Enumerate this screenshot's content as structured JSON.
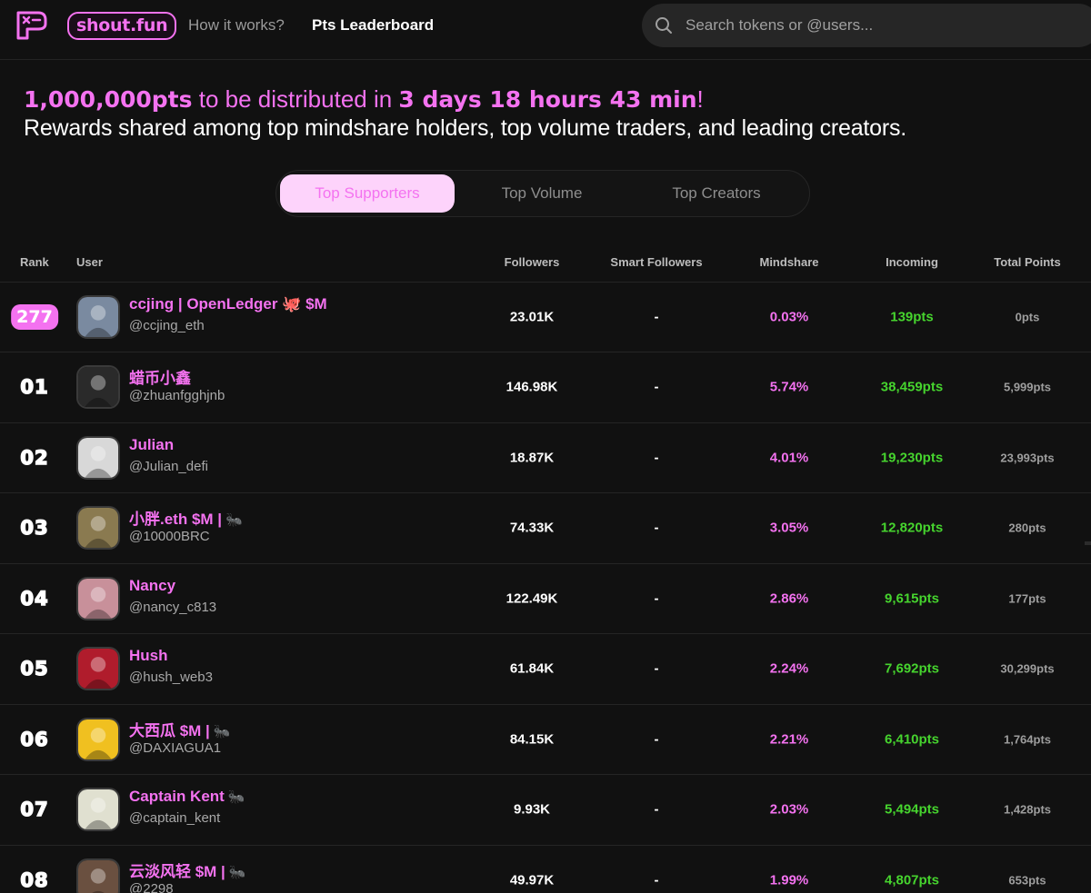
{
  "brand": {
    "name": "shout.fun"
  },
  "nav": {
    "how_it_works": "How it works?",
    "leaderboard": "Pts Leaderboard"
  },
  "search": {
    "placeholder": "Search tokens or @users..."
  },
  "banner": {
    "amount": "1,000,000pts",
    "mid_text": " to be distributed in ",
    "time": "3 days 18 hours 43 min",
    "suffix": "!",
    "subtitle": "Rewards shared among top mindshare holders, top volume traders, and leading creators."
  },
  "tabs": [
    "Top Supporters",
    "Top Volume",
    "Top Creators"
  ],
  "active_tab": "Top Supporters",
  "table": {
    "headers": {
      "rank": "Rank",
      "user": "User",
      "followers": "Followers",
      "smart_followers": "Smart Followers",
      "mindshare": "Mindshare",
      "incoming": "Incoming",
      "total_points": "Total Points"
    },
    "rows": [
      {
        "rank": "277",
        "name": "ccjing | OpenLedger 🐙 $M",
        "handle": "@ccjing_eth",
        "followers": "23.01K",
        "smart_followers": "-",
        "mindshare": "0.03%",
        "incoming": "139pts",
        "total_points": "0pts",
        "avatar_color": "#7a8aa0",
        "current_user": true
      },
      {
        "rank": "01",
        "name": "蜡币小鑫",
        "handle": "@zhuanfgghjnb",
        "followers": "146.98K",
        "smart_followers": "-",
        "mindshare": "5.74%",
        "incoming": "38,459pts",
        "total_points": "5,999pts",
        "avatar_color": "#2a2a2a"
      },
      {
        "rank": "02",
        "name": "Julian",
        "handle": "@Julian_defi",
        "followers": "18.87K",
        "smart_followers": "-",
        "mindshare": "4.01%",
        "incoming": "19,230pts",
        "total_points": "23,993pts",
        "avatar_color": "#d8d8d8"
      },
      {
        "rank": "03",
        "name": "小胖.eth $M |",
        "handle": "@10000BRC",
        "followers": "74.33K",
        "smart_followers": "-",
        "mindshare": "3.05%",
        "incoming": "12,820pts",
        "total_points": "280pts",
        "avatar_color": "#8a7a50",
        "ant": "🐜"
      },
      {
        "rank": "04",
        "name": "Nancy",
        "handle": "@nancy_c813",
        "followers": "122.49K",
        "smart_followers": "-",
        "mindshare": "2.86%",
        "incoming": "9,615pts",
        "total_points": "177pts",
        "avatar_color": "#c8909a"
      },
      {
        "rank": "05",
        "name": "Hush",
        "handle": "@hush_web3",
        "followers": "61.84K",
        "smart_followers": "-",
        "mindshare": "2.24%",
        "incoming": "7,692pts",
        "total_points": "30,299pts",
        "avatar_color": "#b01c2c"
      },
      {
        "rank": "06",
        "name": "大西瓜 $M |",
        "handle": "@DAXIAGUA1",
        "followers": "84.15K",
        "smart_followers": "-",
        "mindshare": "2.21%",
        "incoming": "6,410pts",
        "total_points": "1,764pts",
        "avatar_color": "#f0c020",
        "ant": "🐜"
      },
      {
        "rank": "07",
        "name": "Captain Kent",
        "handle": "@captain_kent",
        "followers": "9.93K",
        "smart_followers": "-",
        "mindshare": "2.03%",
        "incoming": "5,494pts",
        "total_points": "1,428pts",
        "avatar_color": "#e0e0d0",
        "ant": "🐜"
      },
      {
        "rank": "08",
        "name": "云淡风轻 $M |",
        "handle": "@2298",
        "followers": "49.97K",
        "smart_followers": "-",
        "mindshare": "1.99%",
        "incoming": "4,807pts",
        "total_points": "653pts",
        "avatar_color": "#6a5040",
        "ant": "🐜"
      }
    ]
  },
  "colors": {
    "accent": "#f472f0",
    "green": "#46d42e",
    "bg": "#111111",
    "tab_active_bg": "#fdd3fb"
  }
}
